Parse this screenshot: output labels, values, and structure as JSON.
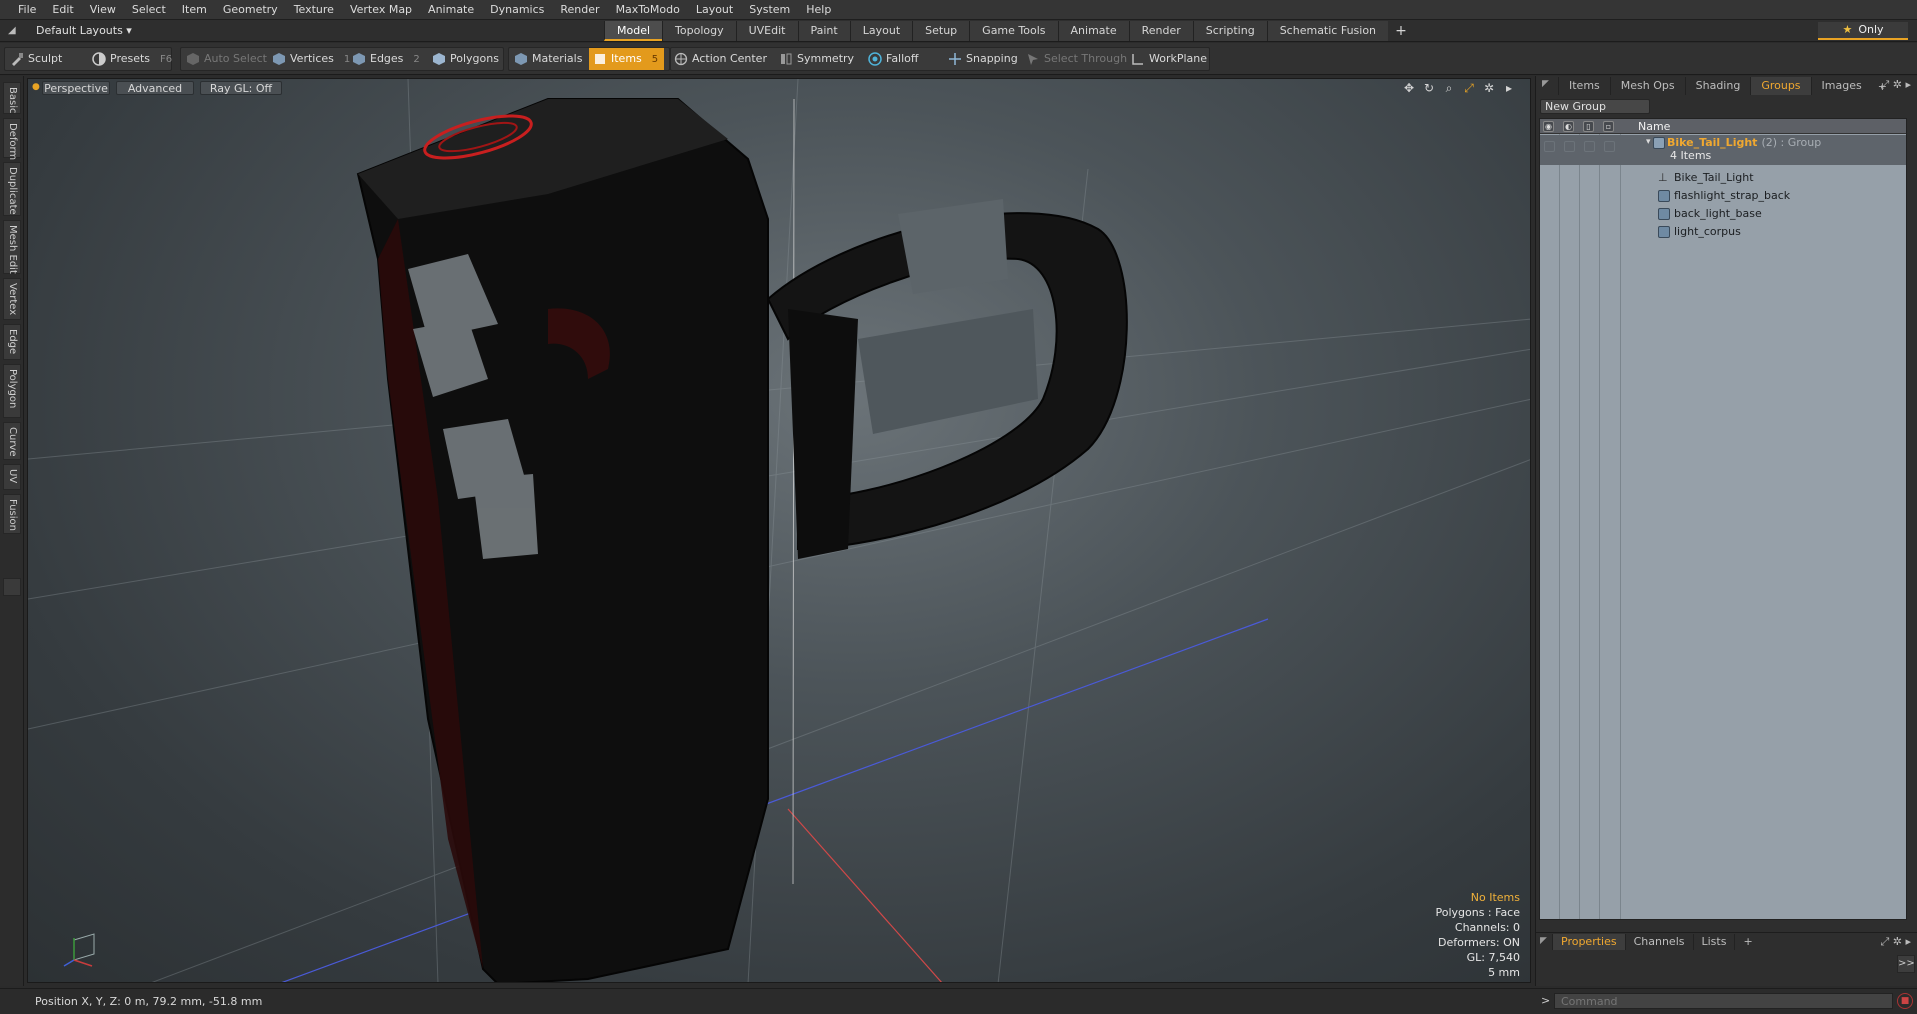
{
  "menu": [
    "File",
    "Edit",
    "View",
    "Select",
    "Item",
    "Geometry",
    "Texture",
    "Vertex Map",
    "Animate",
    "Dynamics",
    "Render",
    "MaxToModo",
    "Layout",
    "System",
    "Help"
  ],
  "layout": {
    "selector_label": "Default Layouts ▾",
    "tabs": [
      "Model",
      "Topology",
      "UVEdit",
      "Paint",
      "Layout",
      "Setup",
      "Game Tools",
      "Animate",
      "Render",
      "Scripting",
      "Schematic Fusion"
    ],
    "active_tab": "Model",
    "add_tab": "+",
    "only_label": "Only",
    "only_star": "★"
  },
  "toolbar": {
    "sculpt": "Sculpt",
    "presets": "Presets",
    "presets_key": "F6",
    "auto_select": "Auto Select",
    "vertices": "Vertices",
    "vertices_key": "1",
    "edges": "Edges",
    "edges_key": "2",
    "polygons": "Polygons",
    "materials": "Materials",
    "items": "Items",
    "items_key": "5",
    "action_center": "Action Center",
    "symmetry": "Symmetry",
    "falloff": "Falloff",
    "snapping": "Snapping",
    "select_through": "Select Through",
    "workplane": "WorkPlane"
  },
  "left_tabs": [
    "Basic",
    "Deform",
    "Duplicate",
    "Mesh Edit",
    "Vertex",
    "Edge",
    "Polygon",
    "Curve",
    "UV",
    "Fusion"
  ],
  "viewport": {
    "view_mode": "Perspective",
    "shading": "Advanced",
    "raygl": "Ray GL: Off",
    "info": {
      "selection": "No Items",
      "polygons": "Polygons : Face",
      "channels": "Channels: 0",
      "deformers": "Deformers: ON",
      "gl": "GL: 7,540",
      "unit": "5 mm"
    }
  },
  "right_panel": {
    "tabs": [
      "Items",
      "Mesh Ops",
      "Shading",
      "Groups",
      "Images"
    ],
    "active_tab": "Groups",
    "add_tab": "+",
    "new_group": "New Group",
    "column_name": "Name",
    "group": {
      "name": "Bike_Tail_Light",
      "meta": "(2) : Group",
      "count": "4 Items",
      "children": [
        "Bike_Tail_Light",
        "flashlight_strap_back",
        "back_light_base",
        "light_corpus"
      ]
    },
    "bottom_tabs": [
      "Properties",
      "Channels",
      "Lists"
    ],
    "bottom_active": "Properties",
    "bottom_add": "+",
    "expand": ">>"
  },
  "status": {
    "position": "Position X, Y, Z:   0 m, 79.2 mm, -51.8 mm"
  },
  "command": {
    "prompt": ">",
    "placeholder": "Command"
  }
}
